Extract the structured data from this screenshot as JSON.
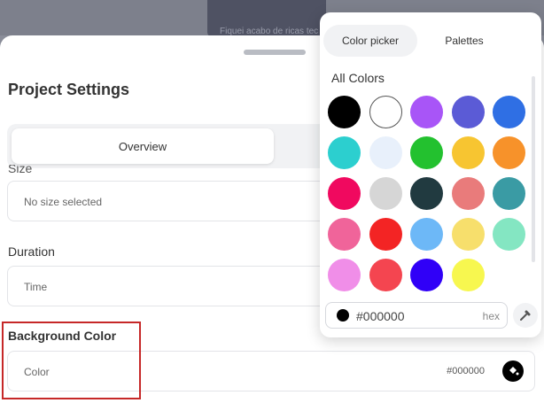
{
  "backdrop": {
    "text": "Fiquei acabo de ricas tec"
  },
  "page": {
    "title": "Project Settings"
  },
  "tabs": {
    "active": "Overview"
  },
  "size": {
    "label": "Size",
    "value": "No size selected"
  },
  "duration": {
    "label": "Duration",
    "value": "Time"
  },
  "background": {
    "label": "Background Color",
    "placeholder": "Color",
    "value": "#000000"
  },
  "picker": {
    "tabs": [
      "Color picker",
      "Palettes"
    ],
    "active_tab": "Color picker",
    "section_title": "All Colors",
    "swatches": [
      "#000000",
      "#ffffff",
      "#a855f7",
      "#5b5bd6",
      "#2f6fe4",
      "#2ccfcf",
      "#e8f0fb",
      "#23c12f",
      "#f7c531",
      "#f7922a",
      "#f0095f",
      "#d6d6d6",
      "#213a40",
      "#e97b7b",
      "#3a9ba4",
      "#f0649a",
      "#f32424",
      "#6db8f7",
      "#f7df6c",
      "#84e6c2",
      "#f08ee8",
      "#f44550",
      "#3000f7",
      "#f7f74f"
    ],
    "hex_value": "#000000",
    "hex_suffix": "hex"
  },
  "colors": {
    "highlight": "#c62828",
    "sheet": "#ffffff",
    "tab_bg": "#f1f2f4"
  }
}
